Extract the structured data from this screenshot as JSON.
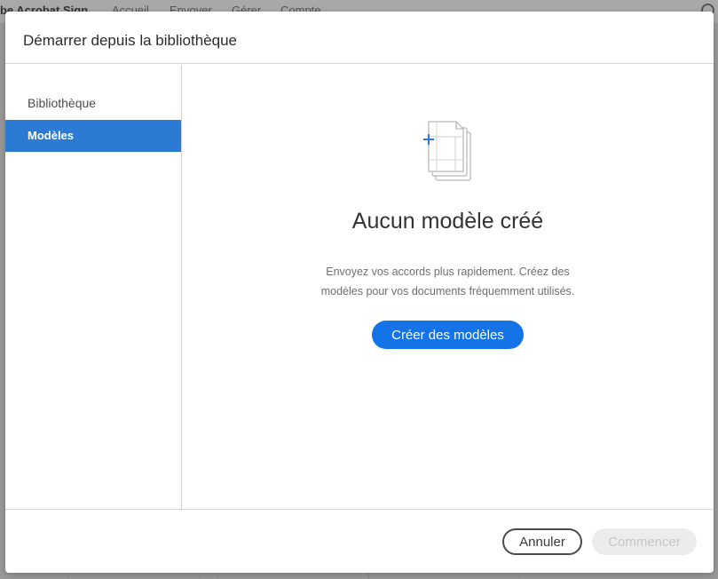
{
  "background": {
    "brand": "obe Acrobat Sign",
    "nav": [
      "Accueil",
      "Envoyer",
      "Gérer",
      "Compte"
    ]
  },
  "dialog": {
    "title": "Démarrer depuis la bibliothèque",
    "sidebar": {
      "items": [
        {
          "label": "Bibliothèque",
          "active": false
        },
        {
          "label": "Modèles",
          "active": true
        }
      ]
    },
    "empty_state": {
      "icon": "template-stack-plus-icon",
      "title": "Aucun modèle créé",
      "text_line1": "Envoyez vos accords plus rapidement. Créez des",
      "text_line2": "modèles pour vos documents fréquemment utilisés.",
      "button_label": "Créer des modèles"
    },
    "footer": {
      "cancel_label": "Annuler",
      "start_label": "Commencer"
    }
  },
  "colors": {
    "accent": "#1473e6",
    "sidebar_active": "#2d7ad5",
    "icon_plus": "#2d7ad5"
  }
}
